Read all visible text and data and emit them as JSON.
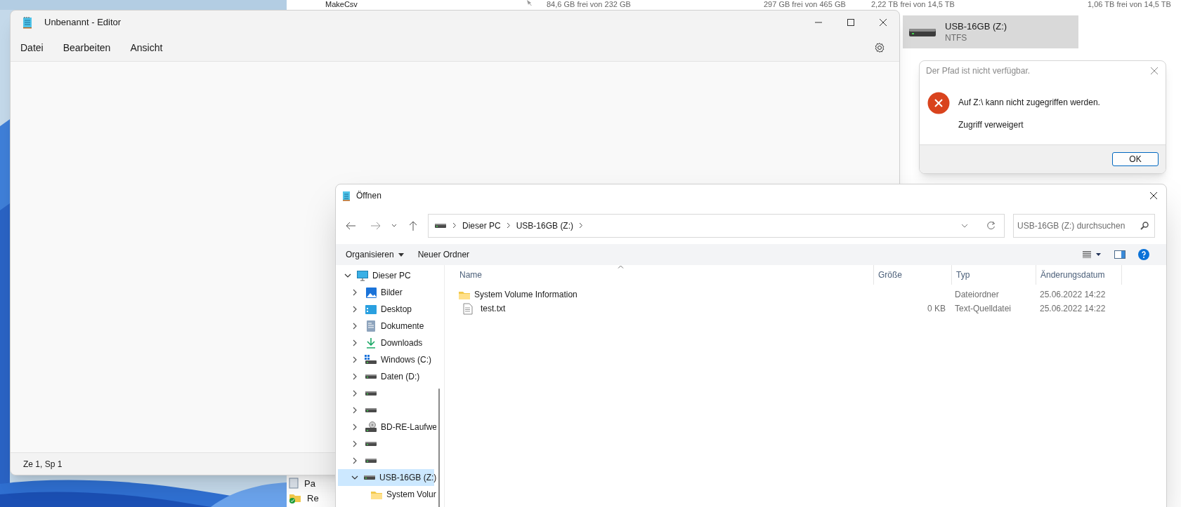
{
  "explorer": {
    "drive_row": [
      {
        "text": "MakeCsv"
      },
      {
        "text": "84,6 GB frei von 232 GB"
      },
      {
        "text": "297 GB frei von 465 GB"
      },
      {
        "text": "2,22 TB frei von 14,5 TB"
      },
      {
        "text": "1,06 TB frei von 14,5 TB"
      }
    ],
    "drive_tile": {
      "name": "USB-16GB (Z:)",
      "filesystem": "NTFS",
      "selected": true
    },
    "nav_items": [
      {
        "label": "Pa",
        "kind": "file"
      },
      {
        "label": "Re",
        "kind": "folder"
      }
    ]
  },
  "editor": {
    "title": "Unbenannt - Editor",
    "menu": [
      "Datei",
      "Bearbeiten",
      "Ansicht"
    ],
    "status_bar": "Ze 1, Sp 1"
  },
  "error_dialog": {
    "title": "Der Pfad ist nicht verfügbar.",
    "message": "Auf Z:\\ kann nicht zugegriffen werden.",
    "detail": "Zugriff verweigert",
    "buttons": [
      "OK"
    ]
  },
  "open_dialog": {
    "title": "Öffnen",
    "breadcrumb": [
      "Dieser PC",
      "USB-16GB (Z:)"
    ],
    "search": {
      "placeholder": "USB-16GB (Z:) durchsuchen"
    },
    "toolbar": [
      {
        "label": "Organisieren",
        "dropdown": true
      },
      {
        "label": "Neuer Ordner",
        "dropdown": false
      }
    ],
    "tree": [
      {
        "label": "Dieser PC",
        "kind": "pc",
        "expanded": true,
        "selected": false,
        "children": [
          {
            "label": "Bilder",
            "kind": "pictures",
            "expanded": false,
            "selected": false
          },
          {
            "label": "Desktop",
            "kind": "desktop",
            "expanded": false,
            "selected": false
          },
          {
            "label": "Dokumente",
            "kind": "documents",
            "expanded": false,
            "selected": false
          },
          {
            "label": "Downloads",
            "kind": "downloads",
            "expanded": false,
            "selected": false
          },
          {
            "label": "Windows (C:)",
            "kind": "system-drive",
            "expanded": false,
            "selected": false
          },
          {
            "label": "Daten (D:)",
            "kind": "drive",
            "expanded": false,
            "selected": false
          },
          {
            "kind": "drive",
            "expanded": false,
            "selected": false
          },
          {
            "kind": "drive",
            "expanded": false,
            "selected": false
          },
          {
            "label": "BD-RE-Laufwe",
            "kind": "optical",
            "expanded": false,
            "selected": false
          },
          {
            "kind": "drive",
            "expanded": false,
            "selected": false
          },
          {
            "kind": "drive",
            "expanded": false,
            "selected": false
          },
          {
            "label": "USB-16GB (Z:)",
            "kind": "drive",
            "expanded": true,
            "selected": true,
            "children": [
              {
                "label": "System Volur",
                "kind": "folder",
                "selected": false
              }
            ]
          }
        ]
      }
    ],
    "columns": [
      "Name",
      "Größe",
      "Typ",
      "Änderungsdatum"
    ],
    "rows": [
      {
        "kind": "folder",
        "name": "System Volume Information",
        "type": "Dateiordner",
        "date": "25.06.2022 14:22"
      },
      {
        "kind": "file",
        "name": "test.txt",
        "size": "0 KB",
        "type": "Text-Quelldatei",
        "date": "25.06.2022 14:22"
      }
    ]
  }
}
